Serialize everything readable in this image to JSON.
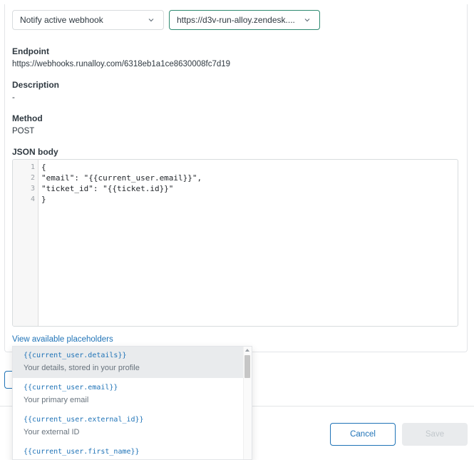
{
  "selects": {
    "action": {
      "value": "Notify active webhook",
      "icon": "chevron-down-icon"
    },
    "target": {
      "value": "https://d3v-run-alloy.zendesk....",
      "icon": "chevron-down-icon"
    }
  },
  "fields": {
    "endpoint": {
      "label": "Endpoint",
      "value": "https://webhooks.runalloy.com/6318eb1a1ce8630008fc7d19"
    },
    "description": {
      "label": "Description",
      "value": "-"
    },
    "method": {
      "label": "Method",
      "value": "POST"
    },
    "json_body": {
      "label": "JSON body"
    }
  },
  "editor": {
    "lines": [
      {
        "num": "1",
        "code": "{"
      },
      {
        "num": "2",
        "code": "\"email\": \"{{current_user.email}}\","
      },
      {
        "num": "3",
        "code": "\"ticket_id\": \"{{ticket.id}}\""
      },
      {
        "num": "4",
        "code": "}"
      }
    ]
  },
  "placeholders_link": "View available placeholders",
  "placeholders": [
    {
      "code": "{{current_user.details}}",
      "desc": "Your details, stored in your profile",
      "hovered": true
    },
    {
      "code": "{{current_user.email}}",
      "desc": "Your primary email",
      "hovered": false
    },
    {
      "code": "{{current_user.external_id}}",
      "desc": "Your external ID",
      "hovered": false
    },
    {
      "code": "{{current_user.first_name}}",
      "desc": "",
      "hovered": false
    }
  ],
  "footer": {
    "cancel_label": "Cancel",
    "save_label": "Save"
  },
  "colors": {
    "accent": "#1f73b7",
    "focus_border": "#2e8a71",
    "disabled_bg": "#e9ebed"
  }
}
